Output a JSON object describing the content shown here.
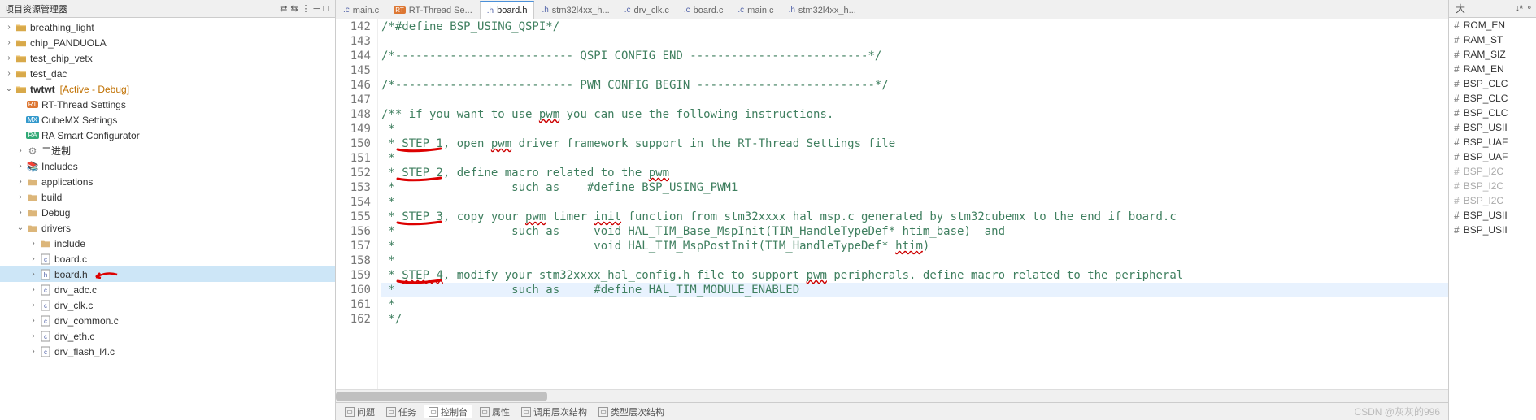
{
  "leftPane": {
    "title": "项目资源管理器",
    "tree": [
      {
        "ind": 1,
        "tw": ">",
        "icon": "proj",
        "label": "breathing_light"
      },
      {
        "ind": 1,
        "tw": ">",
        "icon": "proj",
        "label": "chip_PANDUOLA"
      },
      {
        "ind": 1,
        "tw": ">",
        "icon": "proj",
        "label": "test_chip_vetx"
      },
      {
        "ind": 1,
        "tw": ">",
        "icon": "proj",
        "label": "test_dac"
      },
      {
        "ind": 1,
        "tw": "v",
        "icon": "proj",
        "label": "twtwt",
        "suffix": "[Active - Debug]",
        "bold": true
      },
      {
        "ind": 2,
        "tw": "",
        "icon": "rt",
        "label": "RT-Thread Settings"
      },
      {
        "ind": 2,
        "tw": "",
        "icon": "mx",
        "label": "CubeMX Settings"
      },
      {
        "ind": 2,
        "tw": "",
        "icon": "ra",
        "label": "RA Smart Configurator"
      },
      {
        "ind": 2,
        "tw": ">",
        "icon": "bin",
        "label": "二进制"
      },
      {
        "ind": 2,
        "tw": ">",
        "icon": "inc",
        "label": "Includes"
      },
      {
        "ind": 2,
        "tw": ">",
        "icon": "folder",
        "label": "applications"
      },
      {
        "ind": 2,
        "tw": ">",
        "icon": "folder",
        "label": "build"
      },
      {
        "ind": 2,
        "tw": ">",
        "icon": "folder",
        "label": "Debug"
      },
      {
        "ind": 2,
        "tw": "v",
        "icon": "folder",
        "label": "drivers"
      },
      {
        "ind": 3,
        "tw": ">",
        "icon": "folder",
        "label": "include"
      },
      {
        "ind": 3,
        "tw": ">",
        "icon": "cfile",
        "label": "board.c"
      },
      {
        "ind": 3,
        "tw": ">",
        "icon": "hfile",
        "label": "board.h",
        "sel": true,
        "arrow": true
      },
      {
        "ind": 3,
        "tw": ">",
        "icon": "cfile",
        "label": "drv_adc.c"
      },
      {
        "ind": 3,
        "tw": ">",
        "icon": "cfile",
        "label": "drv_clk.c"
      },
      {
        "ind": 3,
        "tw": ">",
        "icon": "cfile",
        "label": "drv_common.c"
      },
      {
        "ind": 3,
        "tw": ">",
        "icon": "cfile",
        "label": "drv_eth.c"
      },
      {
        "ind": 3,
        "tw": ">",
        "icon": "cfile",
        "label": "drv_flash_l4.c"
      }
    ]
  },
  "tabs": [
    {
      "icon": "c",
      "label": "main.c"
    },
    {
      "icon": "rt",
      "label": "RT-Thread Se..."
    },
    {
      "icon": "h",
      "label": "board.h",
      "active": true
    },
    {
      "icon": "h",
      "label": "stm32l4xx_h..."
    },
    {
      "icon": "c",
      "label": "drv_clk.c"
    },
    {
      "icon": "c",
      "label": "board.c"
    },
    {
      "icon": "c",
      "label": "main.c"
    },
    {
      "icon": "h",
      "label": "stm32l4xx_h..."
    }
  ],
  "code": {
    "start": 142,
    "lines": [
      {
        "t": "/*#define BSP_USING_QSPI*/",
        "cls": "c-comment"
      },
      {
        "t": "",
        "cls": ""
      },
      {
        "t": "/*-------------------------- QSPI CONFIG END --------------------------*/",
        "cls": "c-comment"
      },
      {
        "t": "",
        "cls": ""
      },
      {
        "t": "/*-------------------------- PWM CONFIG BEGIN --------------------------*/",
        "cls": "c-comment"
      },
      {
        "t": "",
        "cls": ""
      },
      {
        "t": "/** if you want to use <u>pwm</u> you can use the following instructions.",
        "cls": "c-comment"
      },
      {
        "t": " *",
        "cls": "c-comment"
      },
      {
        "t": " * STEP 1, open <u>pwm</u> driver framework support in the RT-Thread Settings file",
        "cls": "c-comment",
        "mark": true
      },
      {
        "t": " *",
        "cls": "c-comment"
      },
      {
        "t": " * STEP 2, define macro related to the <u>pwm</u>",
        "cls": "c-comment",
        "mark": true
      },
      {
        "t": " *                 such as    #define BSP_USING_PWM1",
        "cls": "c-comment"
      },
      {
        "t": " *",
        "cls": "c-comment"
      },
      {
        "t": " * STEP 3, copy your <u>pwm</u> timer <u>init</u> function from stm32xxxx_hal_msp.c generated by stm32cubemx to the end if board.c",
        "cls": "c-comment",
        "mark": true
      },
      {
        "t": " *                 such as     void HAL_TIM_Base_MspInit(TIM_HandleTypeDef* htim_base)  and",
        "cls": "c-comment"
      },
      {
        "t": " *                             void HAL_TIM_MspPostInit(TIM_HandleTypeDef* <u>htim</u>)",
        "cls": "c-comment"
      },
      {
        "t": " *",
        "cls": "c-comment"
      },
      {
        "t": " * <u>STEP 4</u>, modify your stm32xxxx_hal_config.h file to support <u>pwm</u> peripherals. define macro related to the peripheral",
        "cls": "c-comment",
        "mark": true
      },
      {
        "t": " *                 such as     #define HAL_TIM_MODULE_ENABLED",
        "cls": "c-comment",
        "hl": true
      },
      {
        "t": " *",
        "cls": "c-comment"
      },
      {
        "t": " */",
        "cls": "c-comment"
      }
    ]
  },
  "bottomTabs": [
    {
      "label": "问题"
    },
    {
      "label": "任务"
    },
    {
      "label": "控制台",
      "active": true
    },
    {
      "label": "属性"
    },
    {
      "label": "调用层次结构"
    },
    {
      "label": "类型层次结构"
    }
  ],
  "outline": {
    "header": "大",
    "items": [
      {
        "h": "#",
        "label": "ROM_EN"
      },
      {
        "h": "#",
        "label": "RAM_ST"
      },
      {
        "h": "#",
        "label": "RAM_SIZ"
      },
      {
        "h": "#",
        "label": "RAM_EN"
      },
      {
        "h": "#",
        "label": "BSP_CLC"
      },
      {
        "h": "#",
        "label": "BSP_CLC"
      },
      {
        "h": "#",
        "label": "BSP_CLC"
      },
      {
        "h": "#",
        "label": "BSP_USII"
      },
      {
        "h": "#",
        "label": "BSP_UAF"
      },
      {
        "h": "#",
        "label": "BSP_UAF"
      },
      {
        "h": "#",
        "gray": true,
        "label": "BSP_I2C"
      },
      {
        "h": "#",
        "gray": true,
        "label": "BSP_I2C"
      },
      {
        "h": "#",
        "gray": true,
        "label": "BSP_I2C"
      },
      {
        "h": "#",
        "label": "BSP_USII"
      },
      {
        "h": "#",
        "label": "BSP_USII"
      }
    ]
  },
  "watermark": "CSDN @灰灰的996"
}
